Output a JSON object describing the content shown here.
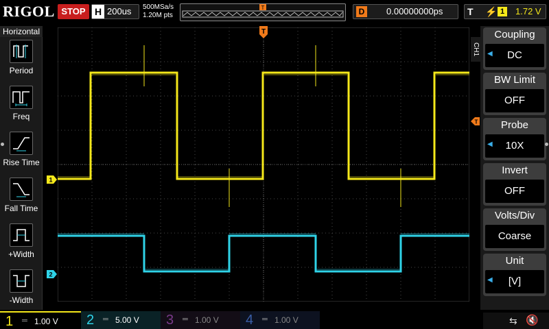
{
  "top": {
    "logo": "RIGOL",
    "run_state": "STOP",
    "h_label": "H",
    "timebase": "200us",
    "sample_rate": "500MSa/s",
    "memory_depth": "1.20M pts",
    "d_label": "D",
    "delay": "0.00000000ps",
    "t_label": "T",
    "trigger_source": "1",
    "trigger_level": "1.72 V",
    "trigger_marker": "T"
  },
  "left_panel": {
    "title": "Horizontal",
    "items": [
      {
        "label": "Period",
        "icon": "period-icon"
      },
      {
        "label": "Freq",
        "icon": "freq-icon"
      },
      {
        "label": "Rise Time",
        "icon": "rise-time-icon"
      },
      {
        "label": "Fall Time",
        "icon": "fall-time-icon"
      },
      {
        "label": "+Width",
        "icon": "positive-width-icon"
      },
      {
        "label": "-Width",
        "icon": "negative-width-icon"
      }
    ]
  },
  "right_panel": {
    "channel_tab": "CH1",
    "items": [
      {
        "title": "Coupling",
        "value": "DC",
        "has_arrow": true
      },
      {
        "title": "BW Limit",
        "value": "OFF",
        "has_arrow": false
      },
      {
        "title": "Probe",
        "value": "10X",
        "has_arrow": true
      },
      {
        "title": "Invert",
        "value": "OFF",
        "has_arrow": false
      },
      {
        "title": "Volts/Div",
        "value": "Coarse",
        "has_arrow": false
      },
      {
        "title": "Unit",
        "value": "[V]",
        "has_arrow": true
      }
    ]
  },
  "waveform": {
    "ch1_marker": "1",
    "ch2_marker": "2",
    "ch1_color": "#f5e81a",
    "ch2_color": "#2fd3e8",
    "trigger_color": "#f07a1a"
  },
  "bottom": {
    "channels": [
      {
        "num": "1",
        "scale": "1.00 V",
        "color": "#f5e81a"
      },
      {
        "num": "2",
        "scale": "5.00 V",
        "color": "#2fd3e8"
      },
      {
        "num": "3",
        "scale": "1.00 V",
        "color": "#7a3a8a"
      },
      {
        "num": "4",
        "scale": "1.00 V",
        "color": "#3a5ea8"
      }
    ],
    "coupling_symbol": "═",
    "usb_glyph": "⇆",
    "sound_glyph": "🔇"
  }
}
